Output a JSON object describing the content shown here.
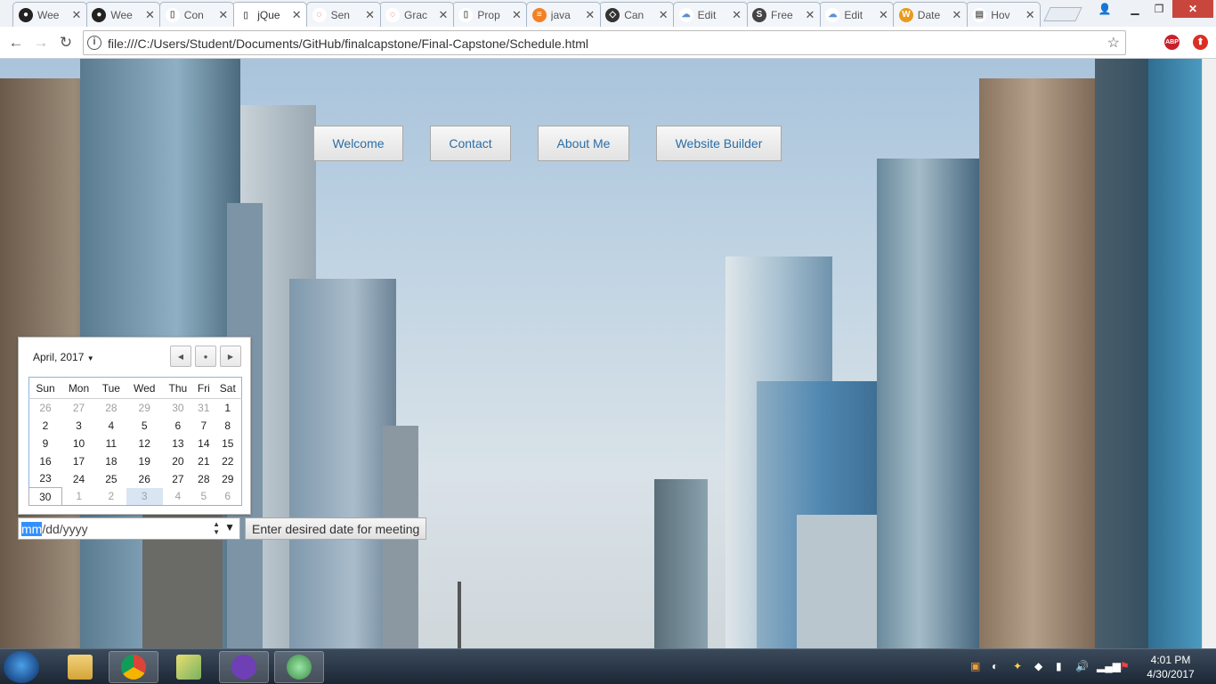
{
  "browser": {
    "tabs": [
      {
        "label": "Wee",
        "icon": "github-icon"
      },
      {
        "label": "Wee",
        "icon": "github-icon"
      },
      {
        "label": "Con",
        "icon": "page-icon"
      },
      {
        "label": "jQue",
        "icon": "page-icon",
        "active": true
      },
      {
        "label": "Sen",
        "icon": "loading-icon"
      },
      {
        "label": "Grac",
        "icon": "loading-icon"
      },
      {
        "label": "Prop",
        "icon": "page-icon"
      },
      {
        "label": "java",
        "icon": "stackoverflow-icon"
      },
      {
        "label": "Can",
        "icon": "codepen-icon"
      },
      {
        "label": "Edit",
        "icon": "cloud-icon"
      },
      {
        "label": "Free",
        "icon": "s-icon"
      },
      {
        "label": "Edit",
        "icon": "cloud-icon"
      },
      {
        "label": "Date",
        "icon": "w3-icon"
      },
      {
        "label": "Hov",
        "icon": "doc-icon"
      }
    ],
    "tab_close": "✕",
    "url": "file:///C:/Users/Student/Documents/GitHub/finalcapstone/Final-Capstone/Schedule.html",
    "abp_label": "ABP"
  },
  "page": {
    "nav": [
      "Welcome",
      "Contact",
      "About Me",
      "Website Builder"
    ]
  },
  "datepicker": {
    "month_label": "April, 2017",
    "weekdays": [
      "Sun",
      "Mon",
      "Tue",
      "Wed",
      "Thu",
      "Fri",
      "Sat"
    ],
    "weeks": [
      [
        "26",
        "27",
        "28",
        "29",
        "30",
        "31",
        "1"
      ],
      [
        "2",
        "3",
        "4",
        "5",
        "6",
        "7",
        "8"
      ],
      [
        "9",
        "10",
        "11",
        "12",
        "13",
        "14",
        "15"
      ],
      [
        "16",
        "17",
        "18",
        "19",
        "20",
        "21",
        "22"
      ],
      [
        "23",
        "24",
        "25",
        "26",
        "27",
        "28",
        "29"
      ],
      [
        "30",
        "1",
        "2",
        "3",
        "4",
        "5",
        "6"
      ]
    ],
    "input_mm": "mm",
    "input_rest": "/dd/yyyy",
    "submit_label": "Enter desired date for meeting"
  },
  "taskbar": {
    "time": "4:01 PM",
    "date": "4/30/2017"
  }
}
